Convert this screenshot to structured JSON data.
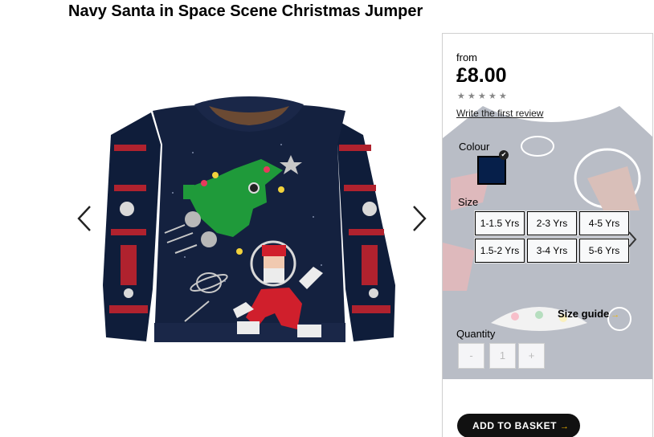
{
  "product": {
    "title": "Navy Santa in Space Scene Christmas Jumper"
  },
  "gallery": {
    "prev_icon": "chevron-left-icon",
    "next_icon": "chevron-right-icon",
    "image": "christmas-jumper-image"
  },
  "panel": {
    "from_label": "from",
    "price": "£8.00",
    "rating_stars": 5,
    "rating_filled": 0,
    "review_link": "Write the first review",
    "colour_label": "Colour",
    "colour_swatch": "#061f4a",
    "size_label": "Size",
    "sizes": [
      "1-1.5 Yrs",
      "2-3 Yrs",
      "4-5 Yrs",
      "1.5-2 Yrs",
      "3-4 Yrs",
      "5-6 Yrs"
    ],
    "size_guide": "Size guide",
    "quantity_label": "Quantity",
    "qty_minus": "-",
    "qty_value": "1",
    "qty_plus": "+",
    "basket_label": "ADD TO BASKET"
  },
  "colors": {
    "navy": "#061f4a",
    "accent": "#f0b400",
    "button": "#111111"
  }
}
